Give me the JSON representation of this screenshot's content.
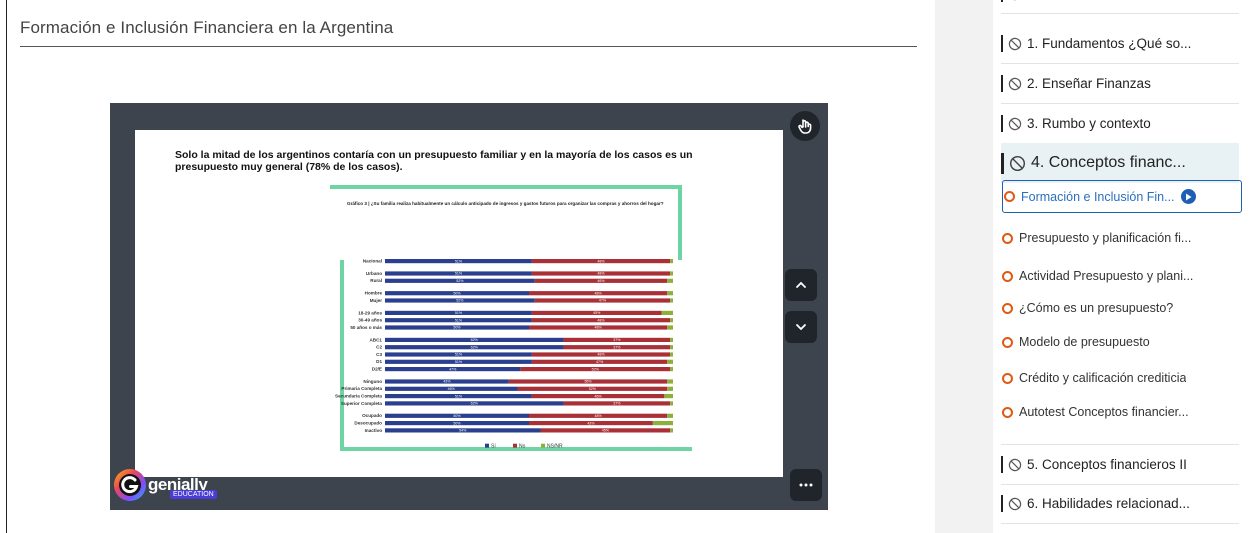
{
  "lesson": {
    "title": "Formación e Inclusión Financiera en la Argentina"
  },
  "slide": {
    "heading": "Solo la mitad de los argentinos contaría con un presupuesto familiar y en la mayoría de los casos es un presupuesto muy general (78% de los casos).",
    "chart_title": "Gráfico 3 | ¿Su familia realiza habitualmente un cálculo anticipado de ingresos y gastos futuros para organizar las compras y ahorros del hogar?"
  },
  "brand": {
    "name": "genially",
    "tag": "EDUCATION"
  },
  "colors": {
    "si": "#2b3f8f",
    "no": "#a83036",
    "nsnr": "#8db03b",
    "accent_green": "#6ed4a4",
    "link_blue": "#1f5fb3",
    "ring_orange": "#e05a13"
  },
  "chart_data": {
    "type": "bar",
    "orientation": "horizontal-stacked-100",
    "title": "Gráfico 3 | ¿Su familia realiza habitualmente un cálculo anticipado de ingresos y gastos futuros para organizar las compras y ahorros del hogar?",
    "legend": [
      "Sí",
      "No",
      "NS/NR"
    ],
    "legend_position": "bottom",
    "groups": [
      {
        "categories": [
          "Nacional"
        ]
      },
      {
        "categories": [
          "Urbano",
          "Rural"
        ]
      },
      {
        "categories": [
          "Hombre",
          "Mujer"
        ]
      },
      {
        "categories": [
          "18-29 años",
          "30-49 años",
          "50 años o más"
        ]
      },
      {
        "categories": [
          "ABC1",
          "C2",
          "C3",
          "D1",
          "D2/E"
        ]
      },
      {
        "categories": [
          "Ninguno",
          "Primaria Completa",
          "Secundaria Completa",
          "Superior Completa"
        ]
      },
      {
        "categories": [
          "Ocupado",
          "Desocupado",
          "Inactivo"
        ]
      }
    ],
    "series": [
      {
        "name": "Sí",
        "values": [
          51,
          51,
          52,
          50,
          52,
          51,
          51,
          50,
          62,
          62,
          51,
          51,
          47,
          43,
          46,
          51,
          62,
          50,
          50,
          54
        ]
      },
      {
        "name": "No",
        "values": [
          48,
          48,
          46,
          48,
          47,
          45,
          48,
          48,
          37,
          37,
          48,
          47,
          52,
          55,
          52,
          46,
          37,
          48,
          43,
          45
        ]
      },
      {
        "name": "NS/NR",
        "values": [
          1,
          1,
          2,
          2,
          1,
          4,
          1,
          2,
          1,
          1,
          1,
          2,
          1,
          2,
          2,
          3,
          1,
          2,
          7,
          1
        ]
      }
    ],
    "xlim": [
      0,
      100
    ]
  },
  "sidebar": {
    "top_item": "",
    "sections": [
      {
        "label": "1. Fundamentos ¿Qué so..."
      },
      {
        "label": "2. Enseñar Finanzas"
      },
      {
        "label": "3. Rumbo y contexto"
      },
      {
        "label": "4. Conceptos financ..."
      },
      {
        "label": "5. Conceptos financieros II"
      },
      {
        "label": "6. Habilidades relacionad..."
      }
    ],
    "lessons": [
      {
        "label": "Formación e Inclusión Fin..."
      },
      {
        "label": "Presupuesto y planificación fi..."
      },
      {
        "label": "Actividad Presupuesto y plani..."
      },
      {
        "label": "¿Cómo es un presupuesto?"
      },
      {
        "label": "Modelo de presupuesto"
      },
      {
        "label": "Crédito y calificación crediticia"
      },
      {
        "label": "Autotest Conceptos financier..."
      }
    ]
  }
}
